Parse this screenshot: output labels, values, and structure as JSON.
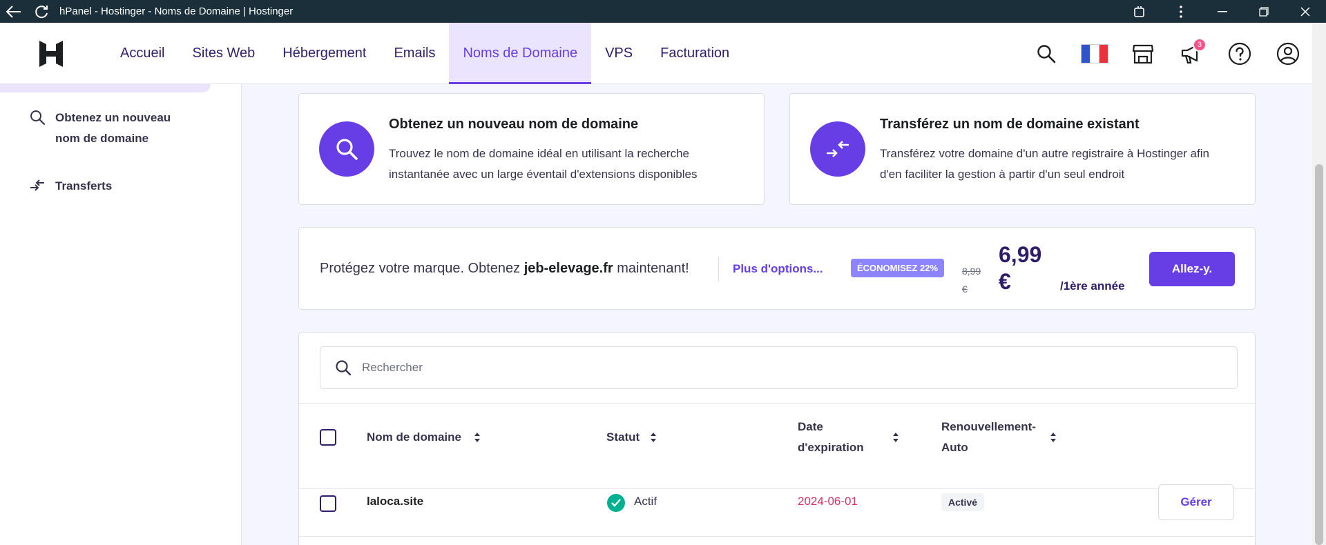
{
  "window": {
    "title": "hPanel - Hostinger - Noms de Domaine | Hostinger"
  },
  "nav": {
    "items": [
      {
        "label": "Accueil"
      },
      {
        "label": "Sites Web"
      },
      {
        "label": "Hébergement"
      },
      {
        "label": "Emails"
      },
      {
        "label": "Noms de Domaine",
        "active": true
      },
      {
        "label": "VPS"
      },
      {
        "label": "Facturation"
      }
    ],
    "notification_count": "3"
  },
  "sidebar": {
    "items": [
      {
        "label_line1": "Obtenez un nouveau",
        "label_line2": "nom de domaine",
        "icon": "search-icon"
      },
      {
        "label": "Transferts",
        "icon": "transfer-icon"
      }
    ]
  },
  "features": [
    {
      "title": "Obtenez un nouveau nom de domaine",
      "desc_line1": "Trouvez le nom de domaine idéal en utilisant la recherche",
      "desc_line2": "instantanée avec un large éventail d'extensions disponibles",
      "icon": "search-icon"
    },
    {
      "title": "Transférez un nom de domaine existant",
      "desc_line1": "Transférez votre domaine d'un autre registraire à Hostinger afin",
      "desc_line2": "d'en faciliter la gestion à partir d'un seul endroit",
      "icon": "transfer-arrows-icon"
    }
  ],
  "promo": {
    "text_before": "Protégez votre marque. Obtenez ",
    "domain": "jeb-elevage.fr",
    "text_after": " maintenant!",
    "more_options": "Plus d'options...",
    "save_badge": "ÉCONOMISEZ 22%",
    "old_price_line1": "8,99",
    "old_price_line2": "€",
    "new_price_line1": "6,99",
    "new_price_line2": "€",
    "period": "/1ère année",
    "cta": "Allez-y."
  },
  "domains": {
    "search_placeholder": "Rechercher",
    "columns": {
      "name": "Nom de domaine",
      "status": "Statut",
      "expiry_line1": "Date",
      "expiry_line2": "d'expiration",
      "renew_line1": "Renouvellement-",
      "renew_line2": "Auto"
    },
    "rows": [
      {
        "name": "laloca.site",
        "status": "Actif",
        "expiry": "2024-06-01",
        "auto_renew": "Activé",
        "action": "Gérer"
      }
    ]
  },
  "colors": {
    "brand": "#673de6",
    "dark": "#2f1c6a",
    "success": "#00b090",
    "expiry": "#d63163"
  }
}
